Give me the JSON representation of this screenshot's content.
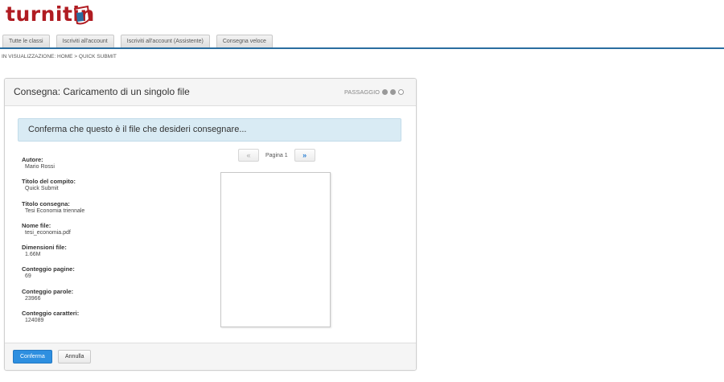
{
  "brand": {
    "logo_text": "turnitin",
    "logo_color": "#b01c22",
    "logo_icon": "turnitin-page-icon"
  },
  "tabs": [
    {
      "label": "Tutte le classi"
    },
    {
      "label": "Iscriviti all'account"
    },
    {
      "label": "Iscriviti all'account (Assistente)"
    },
    {
      "label": "Consegna veloce"
    }
  ],
  "breadcrumb": {
    "prefix": "IN VISUALIZZAZIONE:",
    "path": "HOME > QUICK SUBMIT"
  },
  "panel": {
    "title": "Consegna: Caricamento di un singolo file",
    "step_label": "PASSAGGIO",
    "step_current": 2,
    "step_total": 3,
    "notice": "Conferma che questo è il file che desideri consegnare..."
  },
  "meta": [
    {
      "label": "Autore:",
      "value": "Mario Rossi"
    },
    {
      "label": "Titolo del compito:",
      "value": "Quick Submit"
    },
    {
      "label": "Titolo consegna:",
      "value": "Tesi Economia triennale"
    },
    {
      "label": "Nome file:",
      "value": "tesi_economia.pdf"
    },
    {
      "label": "Dimensioni file:",
      "value": "1.66M"
    },
    {
      "label": "Conteggio pagine:",
      "value": "69"
    },
    {
      "label": "Conteggio parole:",
      "value": "23966"
    },
    {
      "label": "Conteggio caratteri:",
      "value": "124089"
    }
  ],
  "pager": {
    "prev": "«",
    "label": "Pagina 1",
    "next": "»"
  },
  "footer": {
    "confirm_label": "Conferma",
    "cancel_label": "Annulla"
  },
  "colors": {
    "accent_bar": "#2a6ea0",
    "notice_bg": "#d9ebf4",
    "confirm_bg": "#2e8fe0"
  }
}
